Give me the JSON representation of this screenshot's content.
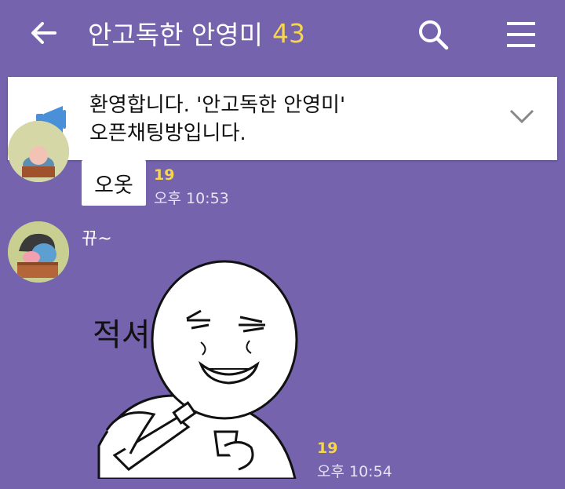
{
  "header": {
    "title": "안고독한 안영미",
    "member_count": "43",
    "back_icon": "back-arrow-icon",
    "search_icon": "search-icon",
    "menu_icon": "hamburger-menu-icon"
  },
  "notice": {
    "line1": "환영합니다. '안고독한 안영미'",
    "line2": "오픈채팅방입니다.",
    "icon": "megaphone-icon",
    "expand_icon": "chevron-down-icon"
  },
  "messages": [
    {
      "text": "오옷",
      "unread": "19",
      "time": "오후 10:53"
    },
    {
      "sender": "뀨~",
      "sticker_caption": "적셔",
      "unread": "19",
      "time": "오후 10:54"
    }
  ],
  "colors": {
    "background": "#7563ad",
    "unread": "#f6d64b",
    "notice_icon": "#4a90d9"
  }
}
